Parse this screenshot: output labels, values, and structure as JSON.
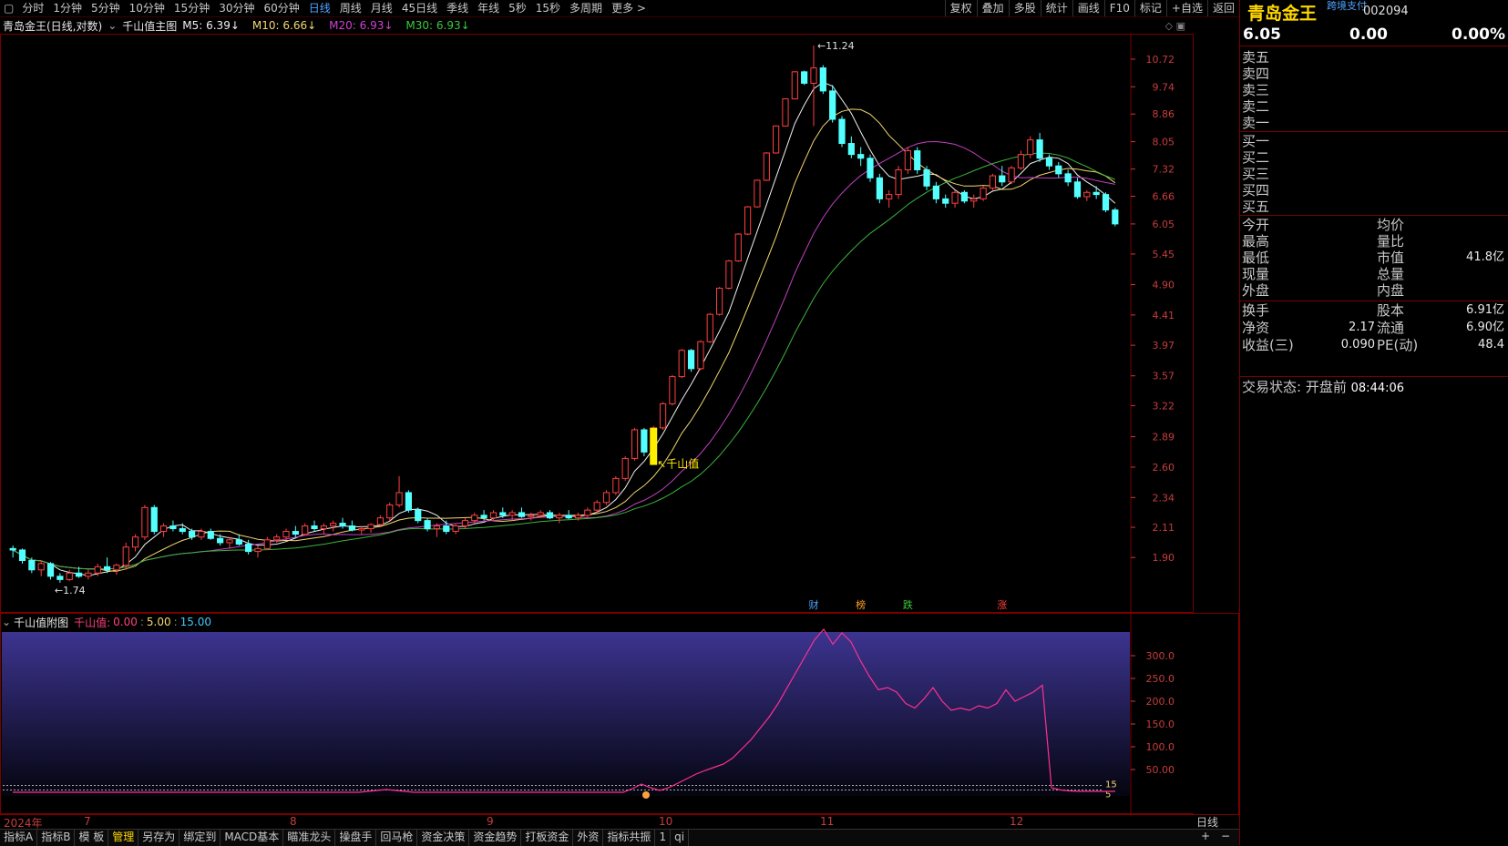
{
  "toolbar": {
    "periods": [
      "分时",
      "1分钟",
      "5分钟",
      "10分钟",
      "15分钟",
      "30分钟",
      "60分钟",
      "日线",
      "周线",
      "月线",
      "45日线",
      "季线",
      "年线",
      "5秒",
      "15秒",
      "多周期",
      "更多 >"
    ],
    "active_period": "日线",
    "right_buttons": [
      "复权",
      "叠加",
      "多股",
      "统计",
      "画线",
      "F10",
      "标记",
      "+自选",
      "返回"
    ]
  },
  "title_row": {
    "stock": "青岛金王(日线,对数)",
    "indicator": "千山值主图",
    "ma": [
      {
        "label": "M5: 6.39",
        "color": "#f0f0f0"
      },
      {
        "label": "M10: 6.66",
        "color": "#f5d76e"
      },
      {
        "label": "M20: 6.93",
        "color": "#d040d0"
      },
      {
        "label": "M30: 6.93",
        "color": "#3cc83c"
      }
    ]
  },
  "main_chart": {
    "price_ticks": [
      "10.72",
      "9.74",
      "8.86",
      "8.05",
      "7.32",
      "6.66",
      "6.05",
      "5.45",
      "4.90",
      "4.41",
      "3.97",
      "3.57",
      "3.22",
      "2.89",
      "2.60",
      "2.34",
      "2.11",
      "1.90"
    ],
    "high_label": "11.24",
    "low_label": "1.74",
    "signal_label": "千山值",
    "event_markers": [
      {
        "text": "财",
        "color": "#4ea2ff"
      },
      {
        "text": "榜",
        "color": "#ffa020"
      },
      {
        "text": "跌",
        "color": "#3cc83c"
      },
      {
        "text": "涨",
        "color": "#ff4040"
      }
    ]
  },
  "chart_data": {
    "type": "candlestick",
    "scale": "log",
    "ylim": [
      1.74,
      11.24
    ],
    "candles": [
      [
        1.96,
        1.98,
        1.9,
        1.95
      ],
      [
        1.95,
        1.96,
        1.86,
        1.88
      ],
      [
        1.88,
        1.9,
        1.8,
        1.82
      ],
      [
        1.82,
        1.88,
        1.78,
        1.86
      ],
      [
        1.86,
        1.87,
        1.76,
        1.78
      ],
      [
        1.78,
        1.8,
        1.74,
        1.76
      ],
      [
        1.76,
        1.82,
        1.75,
        1.8
      ],
      [
        1.8,
        1.84,
        1.77,
        1.78
      ],
      [
        1.78,
        1.82,
        1.76,
        1.8
      ],
      [
        1.8,
        1.86,
        1.78,
        1.84
      ],
      [
        1.84,
        1.9,
        1.8,
        1.82
      ],
      [
        1.82,
        1.86,
        1.79,
        1.85
      ],
      [
        1.85,
        2.0,
        1.82,
        1.97
      ],
      [
        1.97,
        2.06,
        1.94,
        2.04
      ],
      [
        2.04,
        2.28,
        2.02,
        2.26
      ],
      [
        2.26,
        2.28,
        2.06,
        2.08
      ],
      [
        2.08,
        2.14,
        2.04,
        2.12
      ],
      [
        2.12,
        2.16,
        2.08,
        2.1
      ],
      [
        2.1,
        2.14,
        2.06,
        2.08
      ],
      [
        2.08,
        2.1,
        2.02,
        2.04
      ],
      [
        2.04,
        2.1,
        2.02,
        2.08
      ],
      [
        2.08,
        2.1,
        2.02,
        2.03
      ],
      [
        2.03,
        2.06,
        1.98,
        2.0
      ],
      [
        2.0,
        2.04,
        1.96,
        2.02
      ],
      [
        2.02,
        2.06,
        1.98,
        1.99
      ],
      [
        1.99,
        2.02,
        1.92,
        1.94
      ],
      [
        1.94,
        1.98,
        1.9,
        1.96
      ],
      [
        1.96,
        2.04,
        1.95,
        2.02
      ],
      [
        2.02,
        2.06,
        2.0,
        2.04
      ],
      [
        2.04,
        2.1,
        2.02,
        2.08
      ],
      [
        2.08,
        2.12,
        2.04,
        2.06
      ],
      [
        2.06,
        2.14,
        2.05,
        2.12
      ],
      [
        2.12,
        2.16,
        2.08,
        2.1
      ],
      [
        2.1,
        2.14,
        2.06,
        2.12
      ],
      [
        2.12,
        2.16,
        2.08,
        2.14
      ],
      [
        2.14,
        2.18,
        2.1,
        2.12
      ],
      [
        2.12,
        2.16,
        2.08,
        2.09
      ],
      [
        2.09,
        2.12,
        2.06,
        2.1
      ],
      [
        2.1,
        2.14,
        2.07,
        2.13
      ],
      [
        2.13,
        2.2,
        2.12,
        2.18
      ],
      [
        2.18,
        2.3,
        2.16,
        2.28
      ],
      [
        2.28,
        2.52,
        2.26,
        2.38
      ],
      [
        2.38,
        2.4,
        2.22,
        2.24
      ],
      [
        2.24,
        2.26,
        2.14,
        2.16
      ],
      [
        2.16,
        2.18,
        2.08,
        2.1
      ],
      [
        2.1,
        2.14,
        2.04,
        2.12
      ],
      [
        2.12,
        2.16,
        2.06,
        2.08
      ],
      [
        2.08,
        2.14,
        2.06,
        2.12
      ],
      [
        2.12,
        2.18,
        2.1,
        2.16
      ],
      [
        2.16,
        2.22,
        2.14,
        2.2
      ],
      [
        2.2,
        2.24,
        2.16,
        2.18
      ],
      [
        2.18,
        2.24,
        2.16,
        2.22
      ],
      [
        2.22,
        2.26,
        2.18,
        2.2
      ],
      [
        2.2,
        2.24,
        2.16,
        2.22
      ],
      [
        2.22,
        2.26,
        2.18,
        2.19
      ],
      [
        2.19,
        2.22,
        2.16,
        2.2
      ],
      [
        2.2,
        2.24,
        2.18,
        2.22
      ],
      [
        2.22,
        2.24,
        2.17,
        2.18
      ],
      [
        2.18,
        2.22,
        2.14,
        2.2
      ],
      [
        2.2,
        2.24,
        2.17,
        2.18
      ],
      [
        2.18,
        2.22,
        2.16,
        2.2
      ],
      [
        2.2,
        2.26,
        2.18,
        2.24
      ],
      [
        2.24,
        2.32,
        2.22,
        2.3
      ],
      [
        2.3,
        2.4,
        2.28,
        2.38
      ],
      [
        2.38,
        2.52,
        2.36,
        2.5
      ],
      [
        2.5,
        2.7,
        2.48,
        2.68
      ],
      [
        2.68,
        2.98,
        2.66,
        2.96
      ],
      [
        2.96,
        2.98,
        2.7,
        2.74
      ],
      [
        2.74,
        3.0,
        2.7,
        2.98
      ],
      [
        2.98,
        3.26,
        2.96,
        3.24
      ],
      [
        3.24,
        3.58,
        3.22,
        3.56
      ],
      [
        3.56,
        3.92,
        3.54,
        3.9
      ],
      [
        3.9,
        3.92,
        3.62,
        3.66
      ],
      [
        3.66,
        4.04,
        3.64,
        4.02
      ],
      [
        4.02,
        4.44,
        4.0,
        4.42
      ],
      [
        4.42,
        4.86,
        4.4,
        4.84
      ],
      [
        4.84,
        5.34,
        4.82,
        5.32
      ],
      [
        5.32,
        5.86,
        5.3,
        5.84
      ],
      [
        5.84,
        6.44,
        5.82,
        6.42
      ],
      [
        6.42,
        7.06,
        6.4,
        7.04
      ],
      [
        7.04,
        7.76,
        7.02,
        7.74
      ],
      [
        7.74,
        8.52,
        7.72,
        8.5
      ],
      [
        8.5,
        9.36,
        8.48,
        9.34
      ],
      [
        9.34,
        10.28,
        9.32,
        10.26
      ],
      [
        10.26,
        10.3,
        9.8,
        9.86
      ],
      [
        9.86,
        11.24,
        8.5,
        10.4
      ],
      [
        10.4,
        10.5,
        9.5,
        9.6
      ],
      [
        9.6,
        9.8,
        8.6,
        8.7
      ],
      [
        8.7,
        8.8,
        7.9,
        8.0
      ],
      [
        8.0,
        8.2,
        7.6,
        7.7
      ],
      [
        7.7,
        7.9,
        7.4,
        7.6
      ],
      [
        7.6,
        7.7,
        7.0,
        7.1
      ],
      [
        7.1,
        7.2,
        6.5,
        6.6
      ],
      [
        6.6,
        6.8,
        6.4,
        6.7
      ],
      [
        6.7,
        7.4,
        6.6,
        7.3
      ],
      [
        7.3,
        7.9,
        7.2,
        7.8
      ],
      [
        7.8,
        7.9,
        7.2,
        7.3
      ],
      [
        7.3,
        7.4,
        6.8,
        6.9
      ],
      [
        6.9,
        7.0,
        6.5,
        6.6
      ],
      [
        6.6,
        6.7,
        6.4,
        6.5
      ],
      [
        6.5,
        6.8,
        6.4,
        6.75
      ],
      [
        6.75,
        6.8,
        6.5,
        6.55
      ],
      [
        6.55,
        6.7,
        6.4,
        6.6
      ],
      [
        6.6,
        6.9,
        6.55,
        6.85
      ],
      [
        6.85,
        7.2,
        6.8,
        7.15
      ],
      [
        7.15,
        7.4,
        6.9,
        7.0
      ],
      [
        7.0,
        7.4,
        6.95,
        7.35
      ],
      [
        7.35,
        7.8,
        7.3,
        7.7
      ],
      [
        7.7,
        8.2,
        7.6,
        8.1
      ],
      [
        8.1,
        8.3,
        7.5,
        7.6
      ],
      [
        7.6,
        7.7,
        7.3,
        7.4
      ],
      [
        7.4,
        7.5,
        7.1,
        7.2
      ],
      [
        7.2,
        7.3,
        6.9,
        7.0
      ],
      [
        7.0,
        7.1,
        6.6,
        6.65
      ],
      [
        6.65,
        6.8,
        6.55,
        6.75
      ],
      [
        6.75,
        6.9,
        6.6,
        6.7
      ],
      [
        6.7,
        6.75,
        6.3,
        6.35
      ],
      [
        6.35,
        6.4,
        6.0,
        6.05
      ]
    ]
  },
  "sub_chart": {
    "title": "千山值附图",
    "legend_name": "千山值:",
    "legend_values": [
      "0.00",
      "5.00",
      "15.00"
    ],
    "y_ticks": [
      "300.0",
      "250.0",
      "200.0",
      "150.0",
      "100.0",
      "50.00"
    ],
    "level_labels": [
      "15",
      "5"
    ],
    "series": [
      0,
      0,
      0,
      0,
      0,
      0,
      0,
      0,
      0,
      0,
      0,
      0,
      0,
      0,
      0,
      0,
      0,
      0,
      0,
      0,
      0,
      0,
      0,
      0,
      0,
      0,
      0,
      0,
      0,
      0,
      0,
      0,
      0,
      0,
      0,
      0,
      0,
      0,
      0,
      2,
      4,
      6,
      4,
      2,
      0,
      0,
      0,
      0,
      0,
      0,
      0,
      0,
      0,
      0,
      0,
      0,
      0,
      0,
      0,
      0,
      0,
      0,
      0,
      0,
      0,
      0,
      0,
      0,
      8,
      18,
      10,
      4,
      10,
      20,
      30,
      40,
      48,
      55,
      62,
      75,
      95,
      115,
      140,
      165,
      195,
      230,
      265,
      300,
      335,
      358,
      325,
      350,
      330,
      290,
      255,
      225,
      230,
      220,
      195,
      185,
      205,
      230,
      200,
      180,
      185,
      180,
      190,
      185,
      195,
      225,
      200,
      210,
      220,
      235,
      10,
      5,
      3,
      2,
      2,
      2,
      2,
      2
    ]
  },
  "date_axis": [
    "2024年",
    "7",
    "8",
    "9",
    "10",
    "11",
    "12"
  ],
  "period_label": "日线",
  "bottom_tabs": [
    "指标A",
    "指标B",
    "模 板",
    "管理",
    "另存为",
    "绑定到",
    "MACD基本",
    "瞄准龙头",
    "操盘手",
    "回马枪",
    "资金决策",
    "资金趋势",
    "打板资金",
    "外资",
    "指标共振",
    "1",
    "qi"
  ],
  "active_tab": "管理",
  "right_panel": {
    "name": "青岛金王",
    "badge": "跨境支付",
    "code": "002094",
    "price": "6.05",
    "change": "0.00",
    "change_pct": "0.00%",
    "sell_levels": [
      "卖五",
      "卖四",
      "卖三",
      "卖二",
      "卖一"
    ],
    "buy_levels": [
      "买一",
      "买二",
      "买三",
      "买四",
      "买五"
    ],
    "stats_left": [
      "今开",
      "最高",
      "最低",
      "现量",
      "外盘"
    ],
    "stats_right": [
      {
        "label": "均价",
        "value": ""
      },
      {
        "label": "量比",
        "value": ""
      },
      {
        "label": "市值",
        "value": "41.8亿"
      },
      {
        "label": "总量",
        "value": ""
      },
      {
        "label": "内盘",
        "value": ""
      }
    ],
    "fund": [
      {
        "l": "换手",
        "lv": "",
        "r": "股本",
        "rv": "6.91亿"
      },
      {
        "l": "净资",
        "lv": "2.17",
        "r": "流通",
        "rv": "6.90亿"
      },
      {
        "l": "收益(三)",
        "lv": "0.090",
        "r": "PE(动)",
        "rv": "48.4"
      }
    ],
    "trade_status_label": "交易状态:",
    "trade_status": "开盘前",
    "trade_time": "08:44:06"
  }
}
